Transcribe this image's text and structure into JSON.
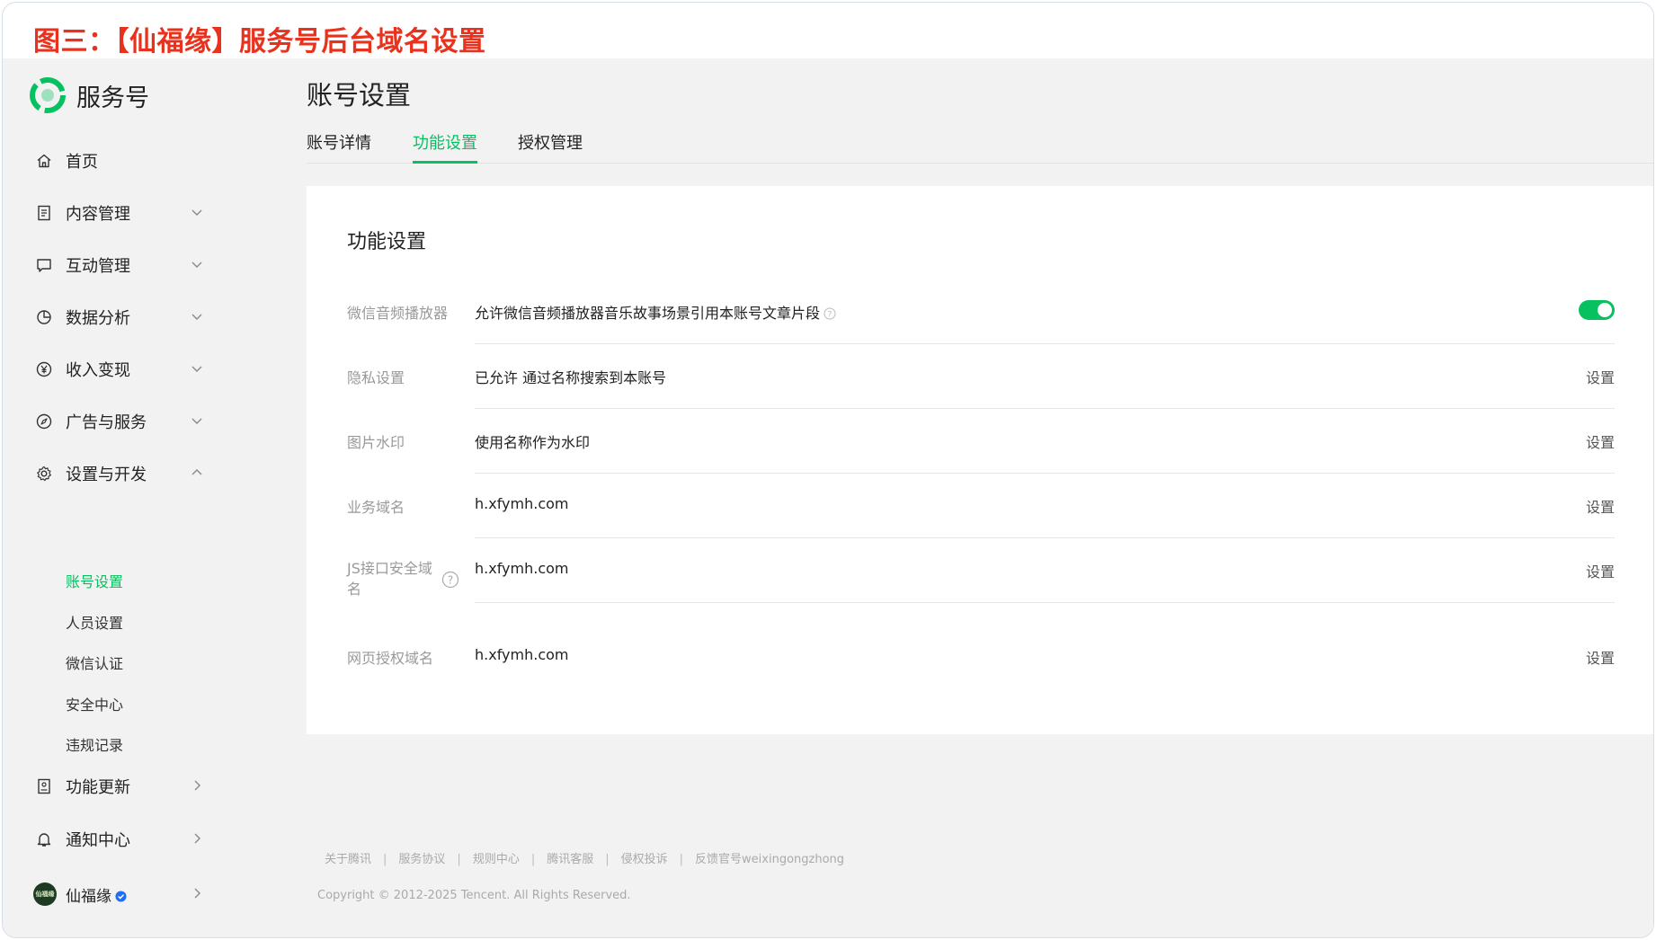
{
  "banner": {
    "title": "图三：【仙福缘】服务号后台域名设置"
  },
  "brand": {
    "name": "服务号",
    "color": "#07c160"
  },
  "sidebar": {
    "items": [
      {
        "label": "首页",
        "icon": "home-icon",
        "chevron": "none"
      },
      {
        "label": "内容管理",
        "icon": "document-icon",
        "chevron": "down"
      },
      {
        "label": "互动管理",
        "icon": "chat-icon",
        "chevron": "down"
      },
      {
        "label": "数据分析",
        "icon": "pie-chart-icon",
        "chevron": "down"
      },
      {
        "label": "收入变现",
        "icon": "yuan-icon",
        "chevron": "down"
      },
      {
        "label": "广告与服务",
        "icon": "compass-icon",
        "chevron": "down"
      },
      {
        "label": "设置与开发",
        "icon": "gear-icon",
        "chevron": "up"
      }
    ],
    "sub_items": [
      "账号设置",
      "人员设置",
      "微信认证",
      "安全中心",
      "违规记录"
    ],
    "active_sub": "账号设置",
    "bottom_items": [
      {
        "label": "功能更新",
        "icon": "update-icon"
      },
      {
        "label": "通知中心",
        "icon": "bell-icon"
      }
    ],
    "account": {
      "name": "仙福缘",
      "avatar_text": "仙福缘",
      "verified": true
    }
  },
  "main": {
    "title": "账号设置",
    "tabs": [
      "账号详情",
      "功能设置",
      "授权管理"
    ],
    "active_tab": "功能设置",
    "card_title": "功能设置",
    "rows": [
      {
        "label": "微信音频播放器",
        "value": "允许微信音频播放器音乐故事场景引用本账号文章片段",
        "action": "",
        "toggle": true
      },
      {
        "label": "隐私设置",
        "value": "已允许 通过名称搜索到本账号",
        "action": "设置"
      },
      {
        "label": "图片水印",
        "value": "使用名称作为水印",
        "action": "设置"
      },
      {
        "label": "业务域名",
        "value": "h.xfymh.com",
        "action": "设置"
      },
      {
        "label": "JS接口安全域",
        "label2": "名",
        "value": "h.xfymh.com",
        "action": "设置"
      },
      {
        "label": "网页授权域名",
        "value": "h.xfymh.com",
        "action": "设置"
      }
    ]
  },
  "footer": {
    "links": [
      "关于腾讯",
      "服务协议",
      "规则中心",
      "腾讯客服",
      "侵权投诉",
      "反馈官号weixingongzhong"
    ],
    "copyright": "Copyright © 2012-2025 Tencent. All Rights Reserved."
  }
}
